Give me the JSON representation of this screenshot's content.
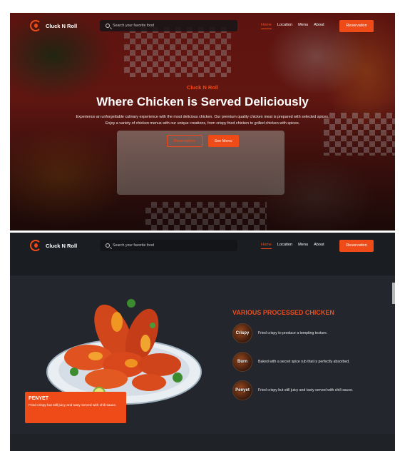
{
  "nav": {
    "brand": "Cluck N Roll",
    "search_placeholder": "Search your favorite food",
    "links": [
      {
        "label": "Home",
        "active": true
      },
      {
        "label": "Location",
        "active": false
      },
      {
        "label": "Menu",
        "active": false
      },
      {
        "label": "About",
        "active": false
      }
    ],
    "reservation_label": "Reservation"
  },
  "hero": {
    "kicker": "Cluck N Roll",
    "title": "Where Chicken is Served Deliciously",
    "description": "Experience an unforgettable culinary experience with the most delicious chicken. Our premium quality chicken meat is prepared with selected spices. Enjoy a variety of chicken menus with our unique creations, from crispy fried chicken to grilled chicken with spices.",
    "reservation_button": "Reservation",
    "menu_button": "See Menu"
  },
  "promo": {
    "title": "PENYET",
    "description": "Fried crispy but still juicy and tasty served with chili sauce."
  },
  "features": {
    "title": "VARIOUS PROCESSED CHICKEN",
    "items": [
      {
        "badge": "Crispy",
        "text": "Fried crispy to produce a tempting texture."
      },
      {
        "badge": "Burn",
        "text": "Baked with a secret spice rub that is perfectly absorbed."
      },
      {
        "badge": "Penyet",
        "text": "Fried crispy but still juicy and tasty served with chili sauce."
      }
    ]
  },
  "colors": {
    "accent": "#ef4b19",
    "dark_bg": "#1f2227",
    "nav_bg": "#1a1d22"
  },
  "icons": [
    "logo-icon",
    "search-icon"
  ]
}
